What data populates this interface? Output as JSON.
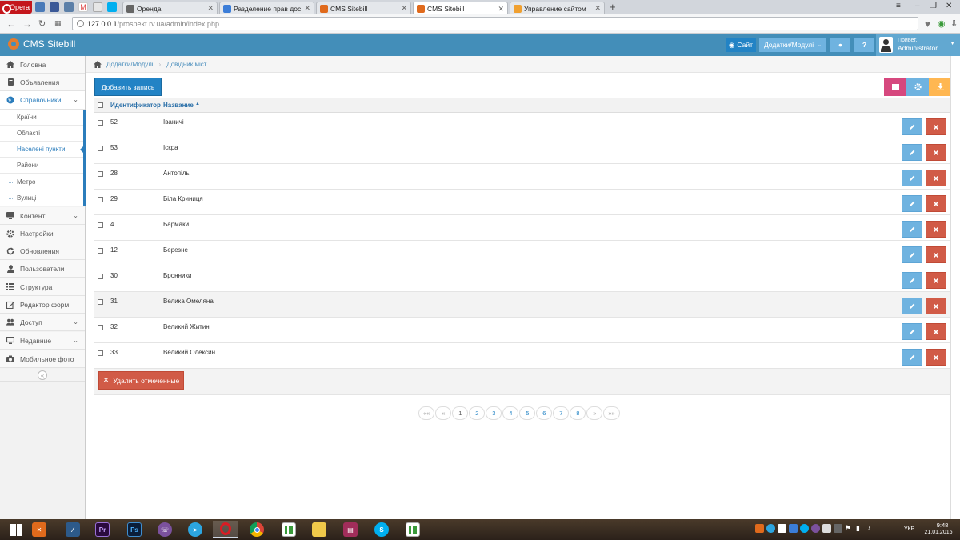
{
  "browser": {
    "menu_label": "Opera",
    "tabs": [
      {
        "label": "Оренда"
      },
      {
        "label": "Разделение прав доступ"
      },
      {
        "label": "CMS Sitebill"
      },
      {
        "label": "CMS Sitebill"
      },
      {
        "label": "Управление сайтом"
      }
    ],
    "url_host": "127.0.0.1",
    "url_path": "/prospekt.rv.ua/admin/index.php"
  },
  "navbar": {
    "brand": "CMS Sitebill",
    "site_btn": "Сайт",
    "modules_btn": "Додатки/Модулі",
    "user_greeting": "Привет,",
    "user_name": "Administrator"
  },
  "sidebar": {
    "items": [
      {
        "label": "Головна",
        "icon": "home-icon"
      },
      {
        "label": "Объявления",
        "icon": "book-icon"
      },
      {
        "label": "Справочники",
        "icon": "globe-icon"
      },
      {
        "label": "Контент",
        "icon": "desktop-icon"
      },
      {
        "label": "Настройки",
        "icon": "gear-icon"
      },
      {
        "label": "Обновления",
        "icon": "refresh-icon"
      },
      {
        "label": "Пользователи",
        "icon": "user-icon"
      },
      {
        "label": "Структура",
        "icon": "list-icon"
      },
      {
        "label": "Редактор форм",
        "icon": "edit-icon"
      },
      {
        "label": "Доступ",
        "icon": "users-icon"
      },
      {
        "label": "Недавние",
        "icon": "monitor-icon"
      },
      {
        "label": "Мобильное фото",
        "icon": "camera-icon"
      }
    ],
    "subitems": [
      {
        "label": "Країни"
      },
      {
        "label": "Області"
      },
      {
        "label": "Населені пункти"
      },
      {
        "label": "Райони"
      },
      {
        "label": "Метро"
      },
      {
        "label": "Вулиці"
      }
    ]
  },
  "breadcrumbs": {
    "items": [
      {
        "label": "Додатки/Модулі"
      },
      {
        "label": "Довідник міст"
      }
    ]
  },
  "main": {
    "add_button": "Добавить запись",
    "columns": {
      "id": "Идентификатор",
      "name": "Название"
    },
    "rows": [
      {
        "id": "52",
        "name": "Іваничі"
      },
      {
        "id": "53",
        "name": "Іскра"
      },
      {
        "id": "28",
        "name": "Антопіль"
      },
      {
        "id": "29",
        "name": "Біла Криниця"
      },
      {
        "id": "4",
        "name": "Бармаки"
      },
      {
        "id": "12",
        "name": "Березне"
      },
      {
        "id": "30",
        "name": "Бронники"
      },
      {
        "id": "31",
        "name": "Велика Омеляна"
      },
      {
        "id": "32",
        "name": "Великий Житин"
      },
      {
        "id": "33",
        "name": "Великий Олексин"
      }
    ],
    "delete_selected": "Удалить отмеченные"
  },
  "pager": {
    "first": "««",
    "prev": "«",
    "pages": [
      "1",
      "2",
      "3",
      "4",
      "5",
      "6",
      "7",
      "8"
    ],
    "current": "1",
    "next": "»",
    "last": "»»"
  },
  "taskbar": {
    "lang": "УКР",
    "time": "9:48",
    "date": "21.01.2016"
  },
  "colors": {
    "navbar": "#438eb9",
    "primary": "#2283c5",
    "edit": "#6fb3e0",
    "danger": "#d15b47",
    "pink": "#d6487e",
    "info": "#6fb3e0",
    "warning": "#ffb752"
  }
}
